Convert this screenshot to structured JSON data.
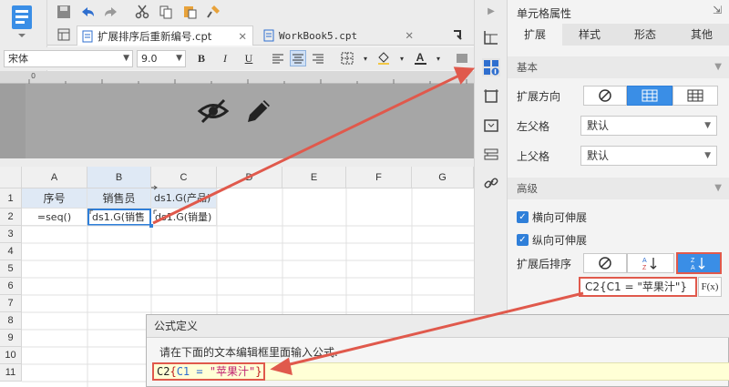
{
  "tabs": [
    {
      "label": "扩展排序后重新编号.cpt",
      "active": true
    },
    {
      "label": "WorkBook5.cpt",
      "active": false
    }
  ],
  "format": {
    "font": "宋体",
    "size": "9.0"
  },
  "columns": [
    "A",
    "B",
    "C",
    "D",
    "E",
    "F",
    "G"
  ],
  "rows": [
    "1",
    "2",
    "3",
    "4",
    "5",
    "6",
    "7",
    "8",
    "9",
    "10",
    "11"
  ],
  "cells": {
    "a1": "序号",
    "b1": "销售员",
    "c1": "ds1.G(产品)",
    "a2": "=seq()",
    "b2": "ds1.G(销售",
    "c2": "ds1.G(销量)"
  },
  "panel": {
    "title": "单元格属性",
    "tabs": [
      "扩展",
      "样式",
      "形态",
      "其他"
    ],
    "basic_header": "基本",
    "expand_dir_label": "扩展方向",
    "left_parent_label": "左父格",
    "left_parent_value": "默认",
    "top_parent_label": "上父格",
    "top_parent_value": "默认",
    "advanced_header": "高级",
    "h_expand_label": "横向可伸展",
    "v_expand_label": "纵向可伸展",
    "sort_label": "扩展后排序",
    "formula_value": "C2{C1 = \"苹果汁\"}",
    "fx_label": "F(x)"
  },
  "dialog": {
    "title": "公式定义",
    "instruction": "请在下面的文本编辑框里面输入公式.",
    "formula_c2": "C2",
    "formula_open": "{",
    "formula_c1": "C1 = ",
    "formula_str": "\"苹果汁\"",
    "formula_close": "}"
  },
  "ruler_label": "0",
  "colors": {
    "accent": "#2f7fd9",
    "highlight": "#e0594c",
    "selected_col": "#dfe9f5"
  }
}
